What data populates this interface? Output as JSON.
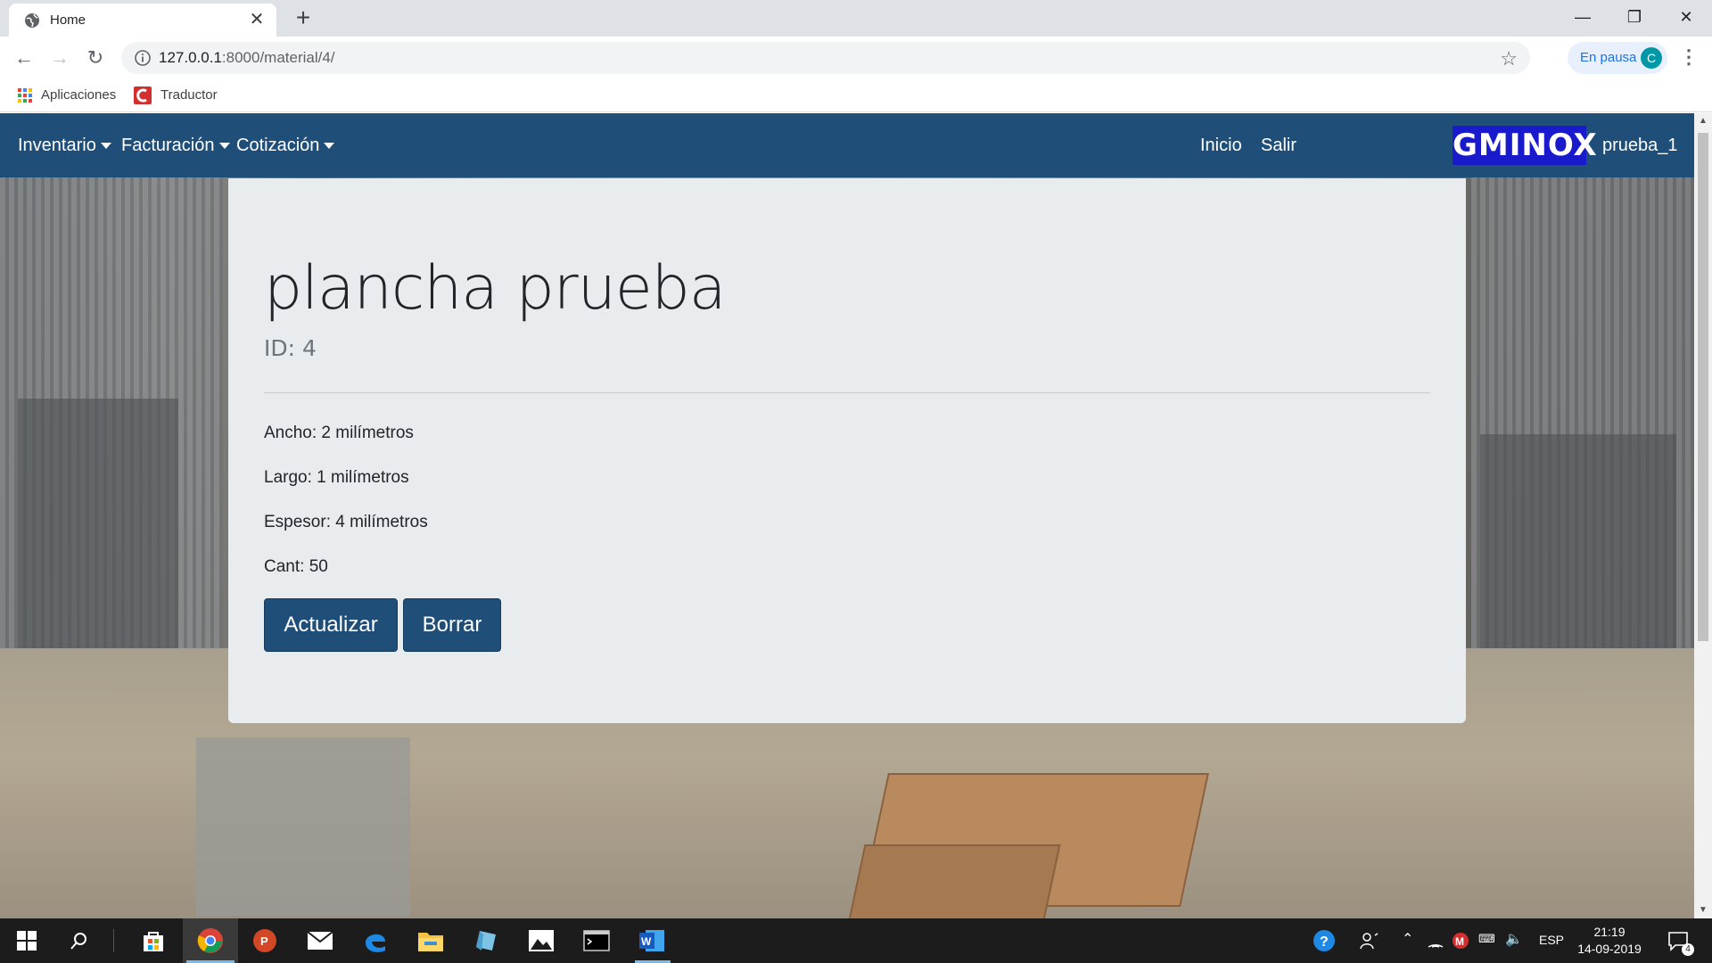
{
  "browser": {
    "tab_title": "Home",
    "url_host": "127.0.0.1",
    "url_path": ":8000/material/4/",
    "profile_label": "En pausa",
    "profile_initial": "C",
    "bookmarks": [
      {
        "label": "Aplicaciones",
        "icon": "apps-grid-icon"
      },
      {
        "label": "Traductor",
        "icon": "translator-icon"
      }
    ]
  },
  "site": {
    "nav": {
      "inventario": "Inventario",
      "facturacion": "Facturación",
      "cotizacion": "Cotización",
      "inicio": "Inicio",
      "salir": "Salir",
      "logo": "GMINOX",
      "user": "prueba_1"
    },
    "colors": {
      "navbar": "#1f4e79",
      "logo_bg": "#1a1acd",
      "card_bg": "#e9ecef"
    }
  },
  "material": {
    "name": "plancha prueba",
    "id_text": "ID: 4",
    "ancho": "Ancho: 2 milímetros",
    "largo": "Largo: 1 milímetros",
    "espesor": "Espesor: 4 milímetros",
    "cant": "Cant: 50",
    "update_label": "Actualizar",
    "delete_label": "Borrar"
  },
  "taskbar": {
    "language": "ESP",
    "time": "21:19",
    "date": "14-09-2019",
    "notifications": "4"
  }
}
